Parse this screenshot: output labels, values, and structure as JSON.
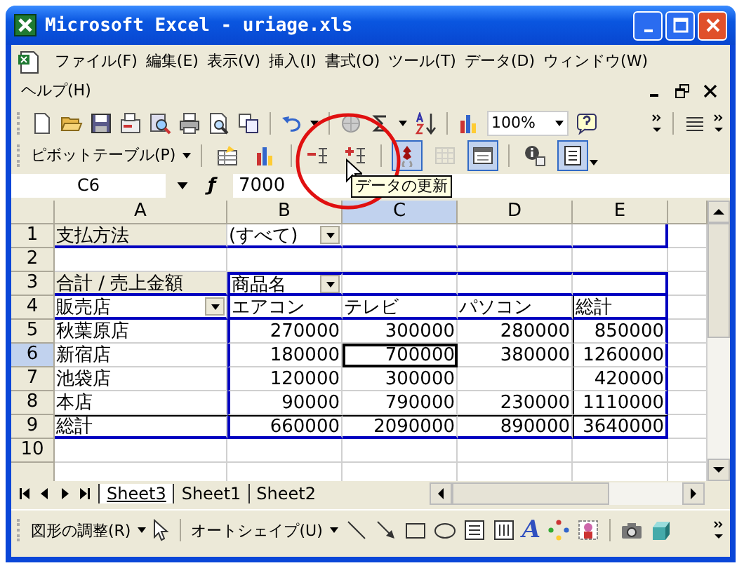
{
  "window": {
    "title": "Microsoft Excel - uriage.xls"
  },
  "menu": [
    "ファイル(F)",
    "編集(E)",
    "表示(V)",
    "挿入(I)",
    "書式(O)",
    "ツール(T)",
    "データ(D)",
    "ウィンドウ(W)",
    "ヘルプ(H)"
  ],
  "standard_toolbar": {
    "zoom": "100%"
  },
  "pivot_toolbar": {
    "menu": "ピボットテーブル(P)",
    "buttons": [
      {
        "pressed": false,
        "disabled": false
      },
      {
        "pressed": false,
        "disabled": false
      },
      {
        "pressed": false,
        "disabled": false
      },
      {
        "pressed": false,
        "disabled": false
      },
      {
        "pressed": true,
        "disabled": false
      },
      {
        "pressed": false,
        "disabled": true
      },
      {
        "pressed": true,
        "disabled": false
      },
      {
        "pressed": false,
        "disabled": false
      },
      {
        "pressed": true,
        "disabled": false
      }
    ]
  },
  "tooltip": "データの更新",
  "formula_bar": {
    "name_box": "C6",
    "function_glyph": "ƒ",
    "value": "7000"
  },
  "columns": [
    {
      "label": "A",
      "selected": false
    },
    {
      "label": "B",
      "selected": false
    },
    {
      "label": "C",
      "selected": true
    },
    {
      "label": "D",
      "selected": false
    },
    {
      "label": "E",
      "selected": false
    }
  ],
  "rows": [
    {
      "number": "1",
      "kind": "page-field",
      "selected": false,
      "cells": [
        "支払方法",
        {
          "text": "(すべて)",
          "dropdown": true
        },
        "",
        "",
        ""
      ]
    },
    {
      "number": "2",
      "kind": "blank",
      "selected": false,
      "cells": [
        "",
        "",
        "",
        "",
        ""
      ]
    },
    {
      "number": "3",
      "kind": "data-field",
      "selected": false,
      "cells": [
        "合計 / 売上金額",
        {
          "text": "商品名",
          "dropdown": true
        },
        "",
        "",
        ""
      ]
    },
    {
      "number": "4",
      "kind": "header",
      "selected": false,
      "cells": [
        {
          "text": "販売店",
          "dropdown": true
        },
        "エアコン",
        "テレビ",
        "パソコン",
        "総計"
      ]
    },
    {
      "number": "5",
      "kind": "item",
      "selected": false,
      "cells": [
        "秋葉原店",
        "270000",
        "300000",
        "280000",
        "850000"
      ]
    },
    {
      "number": "6",
      "kind": "item",
      "selected": true,
      "cells": [
        "新宿店",
        "180000",
        "700000",
        "380000",
        "1260000"
      ]
    },
    {
      "number": "7",
      "kind": "item",
      "selected": false,
      "cells": [
        "池袋店",
        "120000",
        "300000",
        "",
        "420000"
      ]
    },
    {
      "number": "8",
      "kind": "item",
      "selected": false,
      "cells": [
        "本店",
        "90000",
        "790000",
        "230000",
        "1110000"
      ]
    },
    {
      "number": "9",
      "kind": "total",
      "selected": false,
      "cells": [
        "総計",
        "660000",
        "2090000",
        "890000",
        "3640000"
      ]
    },
    {
      "number": "10",
      "kind": "blank",
      "selected": false,
      "cells": [
        "",
        "",
        "",
        "",
        ""
      ]
    }
  ],
  "sheet_tabs": [
    {
      "label": "Sheet3",
      "selected": true
    },
    {
      "label": "Sheet1",
      "selected": false
    },
    {
      "label": "Sheet2",
      "selected": false
    }
  ],
  "drawing_toolbar": {
    "draw_menu": "図形の調整(R)",
    "autoshapes_menu": "オートシェイプ(U)",
    "wordart_glyph": "A"
  }
}
